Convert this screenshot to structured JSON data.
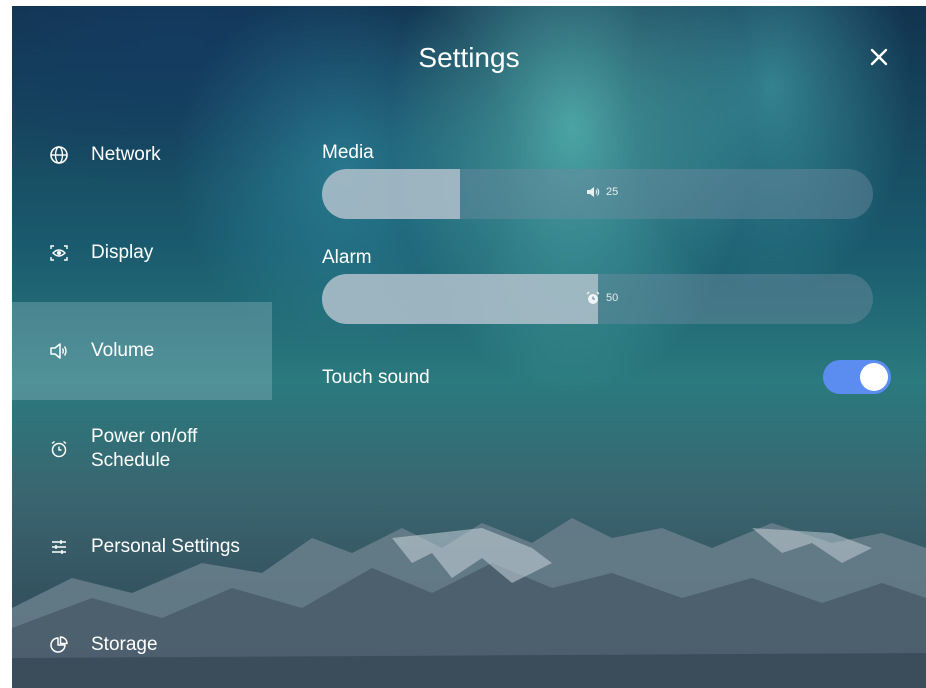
{
  "header": {
    "title": "Settings",
    "close_icon": "close-icon"
  },
  "sidebar": {
    "items": [
      {
        "label": "Network",
        "icon": "globe-icon",
        "active": false
      },
      {
        "label": "Display",
        "icon": "eye-icon",
        "active": false
      },
      {
        "label": "Volume",
        "icon": "speaker-icon",
        "active": true
      },
      {
        "label": "Power on/off Schedule",
        "icon": "alarm-clock-icon",
        "active": false
      },
      {
        "label": "Personal Settings",
        "icon": "sliders-icon",
        "active": false
      },
      {
        "label": "Storage",
        "icon": "pie-chart-icon",
        "active": false
      }
    ]
  },
  "volume": {
    "media": {
      "label": "Media",
      "value": "25",
      "level": 0.25,
      "icon": "speaker-icon"
    },
    "alarm": {
      "label": "Alarm",
      "value": "50",
      "level": 0.5,
      "icon": "alarm-clock-icon"
    },
    "touch_sound": {
      "label": "Touch sound",
      "enabled": true
    }
  },
  "colors": {
    "toggle_on": "#5b8cf0",
    "active_item_bg": "rgba(180,210,220,0.28)"
  }
}
